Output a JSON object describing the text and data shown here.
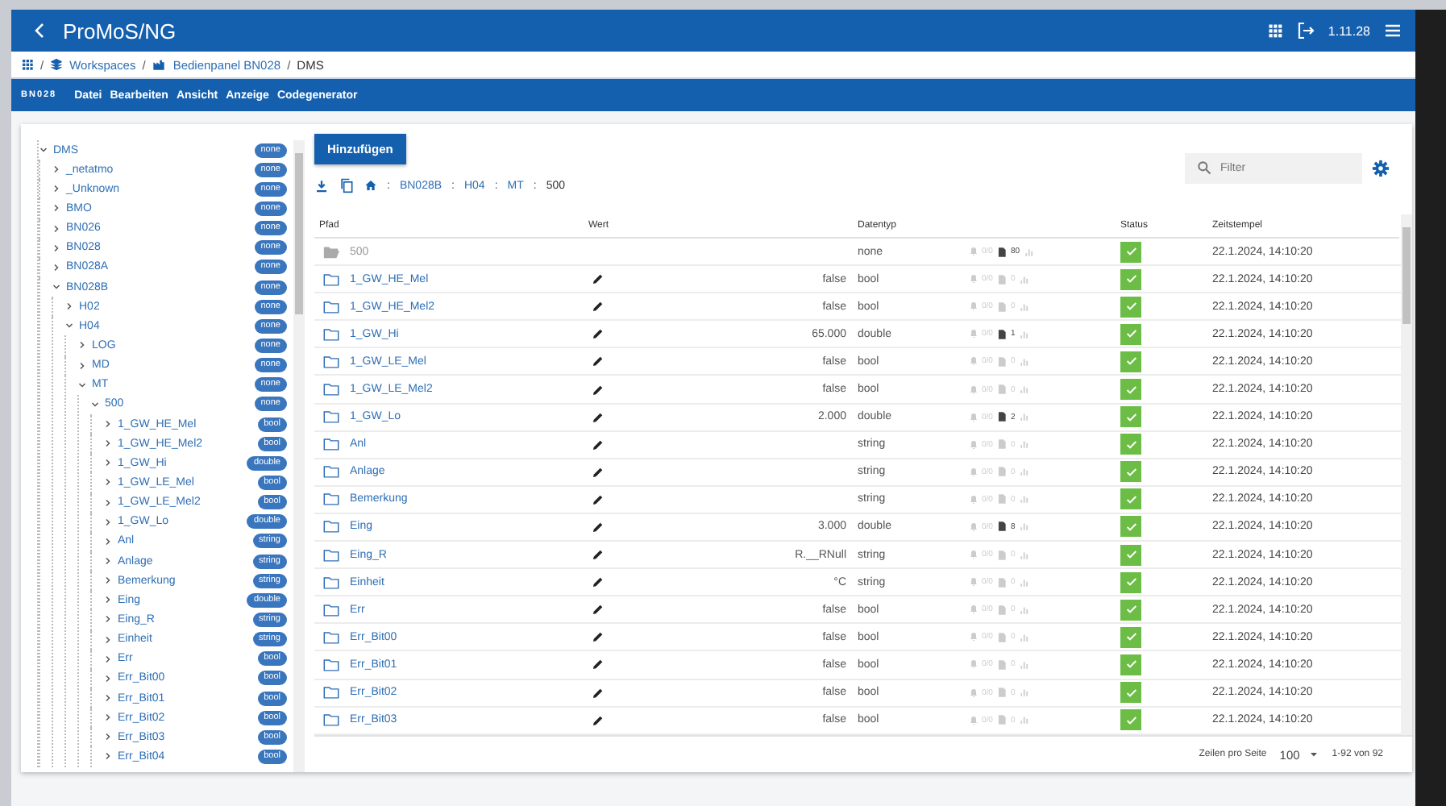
{
  "header": {
    "title": "ProMoS/NG",
    "version": "1.11.28"
  },
  "breadcrumb": {
    "separator": "/",
    "items": [
      {
        "label": "Workspaces"
      },
      {
        "label": "Bedienpanel BN028"
      },
      {
        "label": "DMS"
      }
    ]
  },
  "menubar": {
    "project": "BN028",
    "items": [
      "Datei",
      "Bearbeiten",
      "Ansicht",
      "Anzeige",
      "Codegenerator"
    ]
  },
  "tree": [
    {
      "label": "DMS",
      "badge": "none",
      "expanded": true,
      "children": [
        {
          "label": "_netatmo",
          "badge": "none",
          "expanded": false
        },
        {
          "label": "_Unknown",
          "badge": "none",
          "expanded": false
        },
        {
          "label": "BMO",
          "badge": "none",
          "expanded": false
        },
        {
          "label": "BN026",
          "badge": "none",
          "expanded": false
        },
        {
          "label": "BN028",
          "badge": "none",
          "expanded": false
        },
        {
          "label": "BN028A",
          "badge": "none",
          "expanded": false
        },
        {
          "label": "BN028B",
          "badge": "none",
          "expanded": true,
          "children": [
            {
              "label": "H02",
              "badge": "none",
              "expanded": false
            },
            {
              "label": "H04",
              "badge": "none",
              "expanded": true,
              "children": [
                {
                  "label": "LOG",
                  "badge": "none",
                  "expanded": false
                },
                {
                  "label": "MD",
                  "badge": "none",
                  "expanded": false
                },
                {
                  "label": "MT",
                  "badge": "none",
                  "expanded": true,
                  "children": [
                    {
                      "label": "500",
                      "badge": "none",
                      "expanded": true,
                      "children": [
                        {
                          "label": "1_GW_HE_Mel",
                          "badge": "bool",
                          "expanded": false
                        },
                        {
                          "label": "1_GW_HE_Mel2",
                          "badge": "bool",
                          "expanded": false
                        },
                        {
                          "label": "1_GW_Hi",
                          "badge": "double",
                          "expanded": false
                        },
                        {
                          "label": "1_GW_LE_Mel",
                          "badge": "bool",
                          "expanded": false
                        },
                        {
                          "label": "1_GW_LE_Mel2",
                          "badge": "bool",
                          "expanded": false
                        },
                        {
                          "label": "1_GW_Lo",
                          "badge": "double",
                          "expanded": false
                        },
                        {
                          "label": "Anl",
                          "badge": "string",
                          "expanded": false
                        },
                        {
                          "label": "Anlage",
                          "badge": "string",
                          "expanded": false
                        },
                        {
                          "label": "Bemerkung",
                          "badge": "string",
                          "expanded": false
                        },
                        {
                          "label": "Eing",
                          "badge": "double",
                          "expanded": false
                        },
                        {
                          "label": "Eing_R",
                          "badge": "string",
                          "expanded": false
                        },
                        {
                          "label": "Einheit",
                          "badge": "string",
                          "expanded": false
                        },
                        {
                          "label": "Err",
                          "badge": "bool",
                          "expanded": false
                        },
                        {
                          "label": "Err_Bit00",
                          "badge": "bool",
                          "expanded": false
                        },
                        {
                          "label": "Err_Bit01",
                          "badge": "bool",
                          "expanded": false
                        },
                        {
                          "label": "Err_Bit02",
                          "badge": "bool",
                          "expanded": false
                        },
                        {
                          "label": "Err_Bit03",
                          "badge": "bool",
                          "expanded": false
                        },
                        {
                          "label": "Err_Bit04",
                          "badge": "bool",
                          "expanded": false
                        }
                      ]
                    }
                  ]
                }
              ]
            }
          ]
        }
      ]
    }
  ],
  "toolbar": {
    "add_button": "Hinzufügen",
    "path_separator": ":",
    "path": [
      "BN028B",
      "H04",
      "MT",
      "500"
    ]
  },
  "filter": {
    "placeholder": "Filter"
  },
  "table": {
    "columns": [
      "Pfad",
      "Wert",
      "Datentyp",
      "Status",
      "Zeitstempel"
    ],
    "rows": [
      {
        "kind": "parent",
        "path": "500",
        "value": "",
        "type": "none",
        "alarms": "0/0",
        "trends": "80",
        "trend_active": true,
        "status_ok": true,
        "time": "22.1.2024, 14:10:20"
      },
      {
        "kind": "item",
        "path": "1_GW_HE_Mel",
        "value": "false",
        "type": "bool",
        "alarms": "0/0",
        "trends": "0",
        "trend_active": false,
        "status_ok": true,
        "time": "22.1.2024, 14:10:20"
      },
      {
        "kind": "item",
        "path": "1_GW_HE_Mel2",
        "value": "false",
        "type": "bool",
        "alarms": "0/0",
        "trends": "0",
        "trend_active": false,
        "status_ok": true,
        "time": "22.1.2024, 14:10:20"
      },
      {
        "kind": "item",
        "path": "1_GW_Hi",
        "value": "65.000",
        "type": "double",
        "alarms": "0/0",
        "trends": "1",
        "trend_active": true,
        "status_ok": true,
        "time": "22.1.2024, 14:10:20"
      },
      {
        "kind": "item",
        "path": "1_GW_LE_Mel",
        "value": "false",
        "type": "bool",
        "alarms": "0/0",
        "trends": "0",
        "trend_active": false,
        "status_ok": true,
        "time": "22.1.2024, 14:10:20"
      },
      {
        "kind": "item",
        "path": "1_GW_LE_Mel2",
        "value": "false",
        "type": "bool",
        "alarms": "0/0",
        "trends": "0",
        "trend_active": false,
        "status_ok": true,
        "time": "22.1.2024, 14:10:20"
      },
      {
        "kind": "item",
        "path": "1_GW_Lo",
        "value": "2.000",
        "type": "double",
        "alarms": "0/0",
        "trends": "2",
        "trend_active": true,
        "status_ok": true,
        "time": "22.1.2024, 14:10:20"
      },
      {
        "kind": "item",
        "path": "Anl",
        "value": "",
        "type": "string",
        "alarms": "0/0",
        "trends": "0",
        "trend_active": false,
        "status_ok": true,
        "time": "22.1.2024, 14:10:20"
      },
      {
        "kind": "item",
        "path": "Anlage",
        "value": "",
        "type": "string",
        "alarms": "0/0",
        "trends": "0",
        "trend_active": false,
        "status_ok": true,
        "time": "22.1.2024, 14:10:20"
      },
      {
        "kind": "item",
        "path": "Bemerkung",
        "value": "",
        "type": "string",
        "alarms": "0/0",
        "trends": "0",
        "trend_active": false,
        "status_ok": true,
        "time": "22.1.2024, 14:10:20"
      },
      {
        "kind": "item",
        "path": "Eing",
        "value": "3.000",
        "type": "double",
        "alarms": "0/0",
        "trends": "8",
        "trend_active": true,
        "status_ok": true,
        "time": "22.1.2024, 14:10:20"
      },
      {
        "kind": "item",
        "path": "Eing_R",
        "value": "R.__RNull",
        "type": "string",
        "alarms": "0/0",
        "trends": "0",
        "trend_active": false,
        "status_ok": true,
        "time": "22.1.2024, 14:10:20"
      },
      {
        "kind": "item",
        "path": "Einheit",
        "value": "°C",
        "type": "string",
        "alarms": "0/0",
        "trends": "0",
        "trend_active": false,
        "status_ok": true,
        "time": "22.1.2024, 14:10:20"
      },
      {
        "kind": "item",
        "path": "Err",
        "value": "false",
        "type": "bool",
        "alarms": "0/0",
        "trends": "0",
        "trend_active": false,
        "status_ok": true,
        "time": "22.1.2024, 14:10:20"
      },
      {
        "kind": "item",
        "path": "Err_Bit00",
        "value": "false",
        "type": "bool",
        "alarms": "0/0",
        "trends": "0",
        "trend_active": false,
        "status_ok": true,
        "time": "22.1.2024, 14:10:20"
      },
      {
        "kind": "item",
        "path": "Err_Bit01",
        "value": "false",
        "type": "bool",
        "alarms": "0/0",
        "trends": "0",
        "trend_active": false,
        "status_ok": true,
        "time": "22.1.2024, 14:10:20"
      },
      {
        "kind": "item",
        "path": "Err_Bit02",
        "value": "false",
        "type": "bool",
        "alarms": "0/0",
        "trends": "0",
        "trend_active": false,
        "status_ok": true,
        "time": "22.1.2024, 14:10:20"
      },
      {
        "kind": "item",
        "path": "Err_Bit03",
        "value": "false",
        "type": "bool",
        "alarms": "0/0",
        "trends": "0",
        "trend_active": false,
        "status_ok": true,
        "time": "22.1.2024, 14:10:20"
      }
    ]
  },
  "pagination": {
    "label": "Zeilen pro Seite",
    "per_page": "100",
    "range": "1-92 von 92"
  }
}
